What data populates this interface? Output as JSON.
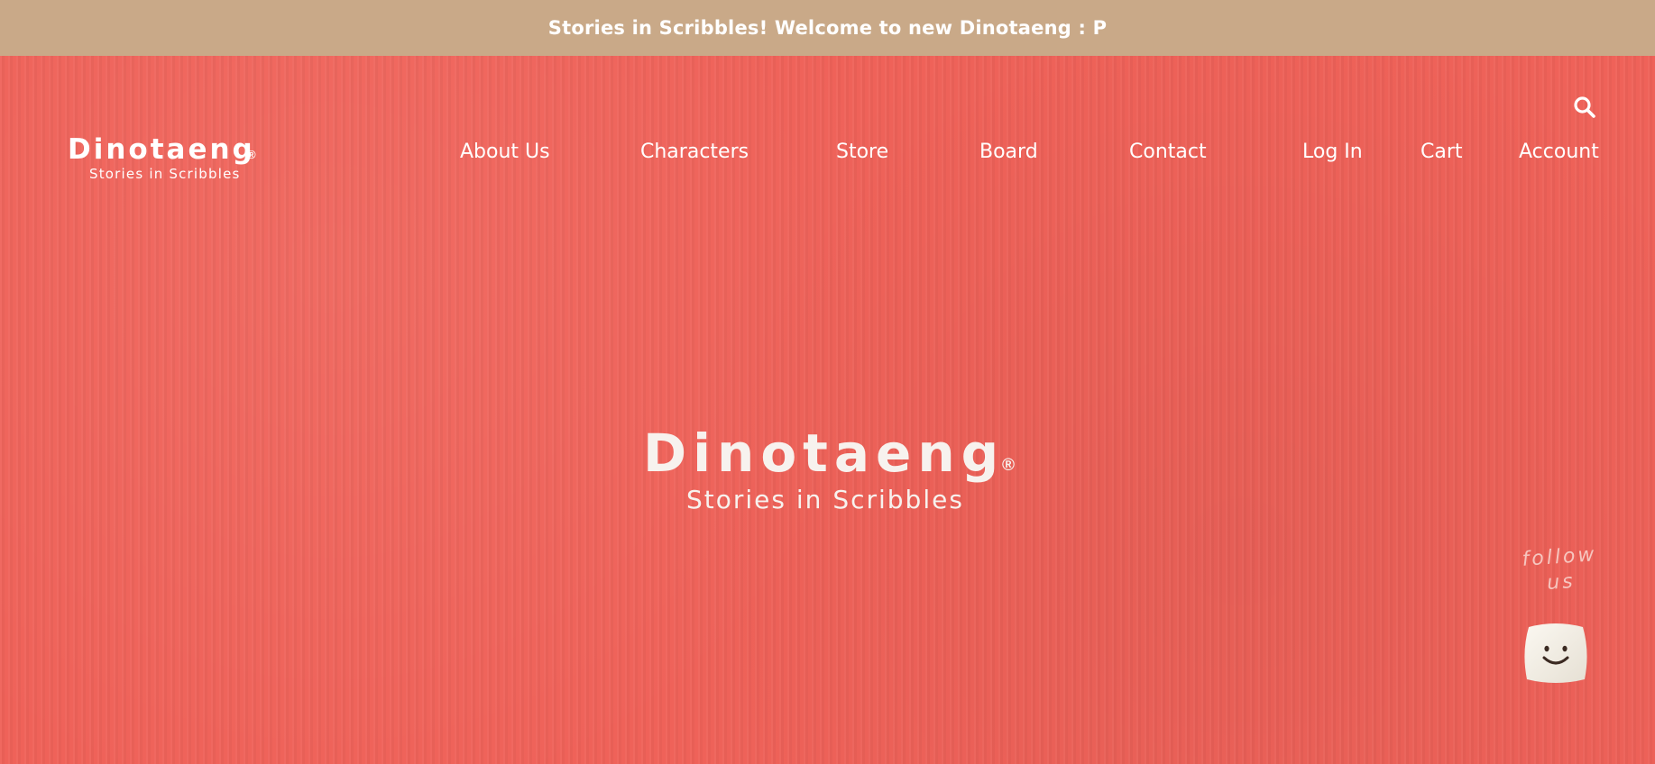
{
  "announcement": {
    "text": "Stories in Scribbles! Welcome to new Dinotaeng : P"
  },
  "header": {
    "logo": {
      "name": "Dinotaeng",
      "registered": "®",
      "tagline": "Stories in Scribbles"
    },
    "nav": [
      {
        "label": "About Us"
      },
      {
        "label": "Characters"
      },
      {
        "label": "Store"
      },
      {
        "label": "Board"
      },
      {
        "label": "Contact"
      }
    ],
    "utility": [
      {
        "label": "Log In"
      },
      {
        "label": "Cart"
      },
      {
        "label": "Account"
      }
    ],
    "search_icon": "search-icon"
  },
  "hero": {
    "logo": {
      "name": "Dinotaeng",
      "registered": "®",
      "tagline": "Stories in Scribbles"
    }
  },
  "follow": {
    "text_line1": "follow",
    "text_line2": "us",
    "icon": "smiley-mascot-icon"
  },
  "colors": {
    "announcement_bg": "#c9a988",
    "hero_bg": "#ef6259",
    "text": "#ffffff"
  }
}
